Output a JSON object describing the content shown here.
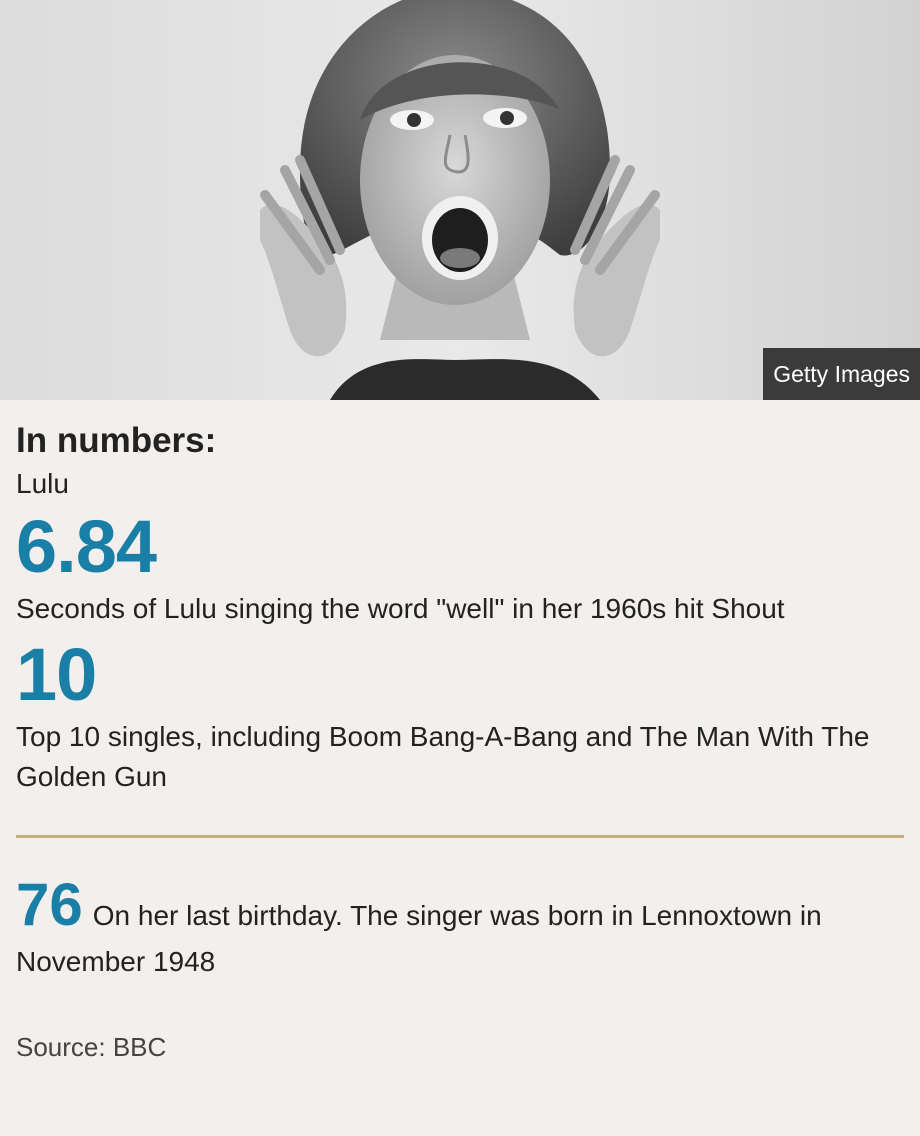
{
  "image": {
    "credit": "Getty Images"
  },
  "heading": "In numbers:",
  "subheading": "Lulu",
  "stats": [
    {
      "value": "6.84",
      "description": "Seconds of Lulu singing the word \"well\" in her 1960s hit Shout"
    },
    {
      "value": "10",
      "description": "Top 10 singles, including Boom Bang-A-Bang and The Man With The Golden Gun"
    }
  ],
  "inline_stat": {
    "value": "76",
    "description": "On her last birthday. The singer was born in Lennoxtown in November 1948"
  },
  "source": "Source: BBC",
  "colors": {
    "accent": "#1a7fa6",
    "divider": "#c7ae7e",
    "background": "#f2efec"
  }
}
